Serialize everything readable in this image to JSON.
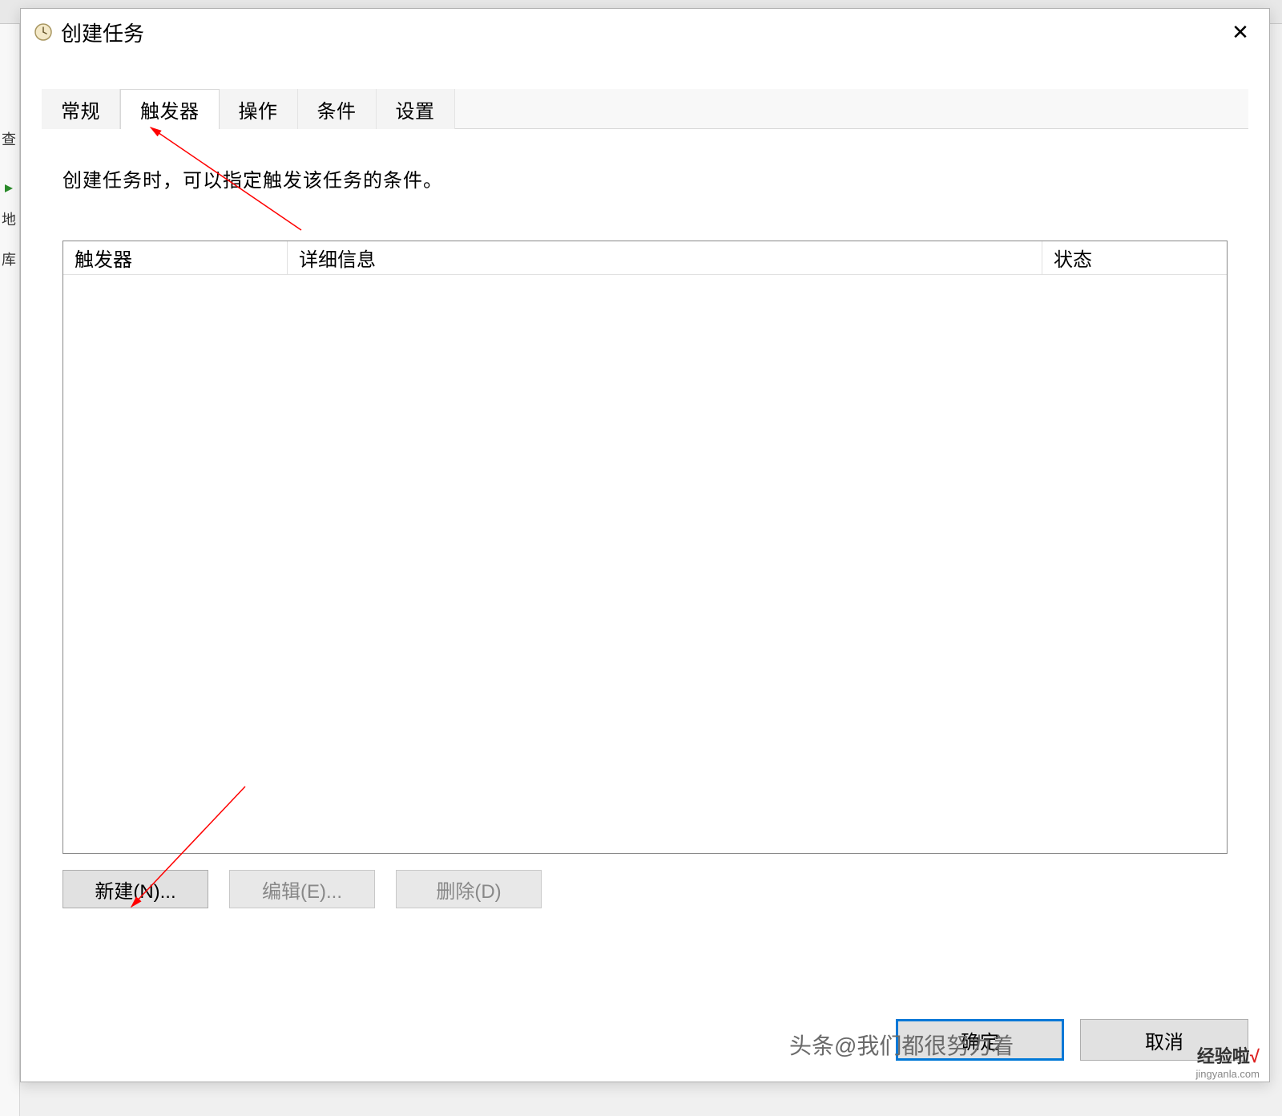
{
  "dialog": {
    "title": "创建任务",
    "closeLabel": "✕"
  },
  "tabs": {
    "general": "常规",
    "triggers": "触发器",
    "actions": "操作",
    "conditions": "条件",
    "settings": "设置"
  },
  "content": {
    "description": "创建任务时，可以指定触发该任务的条件。"
  },
  "columns": {
    "trigger": "触发器",
    "detail": "详细信息",
    "status": "状态"
  },
  "buttons": {
    "new": "新建(N)...",
    "edit": "编辑(E)...",
    "delete": "删除(D)",
    "ok": "确定",
    "cancel": "取消"
  },
  "watermark": {
    "text": "头条@我们都很努力着",
    "brand": "经验啦",
    "domain": "jingyanla.com"
  }
}
